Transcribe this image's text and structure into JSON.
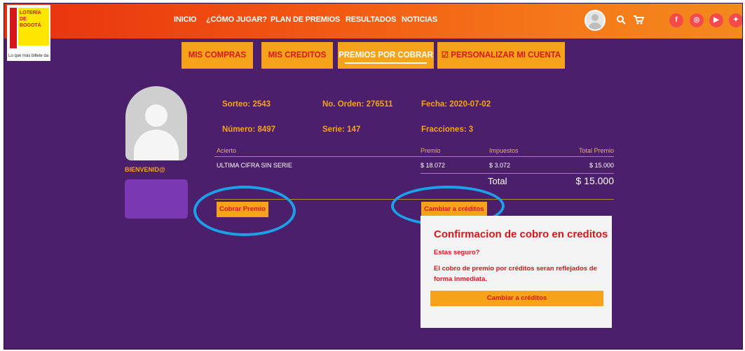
{
  "logo": {
    "line1": "LOTERÍA",
    "line2": "DE",
    "line3": "BOGOTÁ",
    "tagline": "Lo que más billete da"
  },
  "nav": [
    "INICIO",
    "¿CÓMO JUGAR?",
    "PLAN DE PREMIOS",
    "RESULTADOS",
    "NOTICIAS"
  ],
  "icons": {
    "search": "search-icon",
    "cart": "cart-icon",
    "social": [
      "facebook-icon",
      "instagram-icon",
      "youtube-icon",
      "twitter-icon"
    ]
  },
  "social_glyphs": [
    "f",
    "◎",
    "▶",
    "✦"
  ],
  "tabs": [
    "MIS COMPRAS",
    "MIS CREDITOS",
    "PREMIOS POR COBRAR",
    "☑ PERSONALIZAR MI CUENTA"
  ],
  "profile": {
    "welcome": "BIENVENID@"
  },
  "purchase": {
    "sorteo": "Sorteo: 2543",
    "orden": "No. Orden: 276511",
    "fecha": "Fecha: 2020-07-02",
    "numero": "Número: 8497",
    "serie": "Serie: 147",
    "fracciones": "Fracciones: 3"
  },
  "table": {
    "headers": [
      "Acierto",
      "Premio",
      "Impuestos",
      "Total Premio"
    ],
    "rows": [
      [
        "ULTIMA CIFRA SIN SERIE",
        "$ 18.072",
        "$ 3.072",
        "$ 15.000"
      ]
    ],
    "total_label": "Total",
    "total_value": "$ 15.000"
  },
  "buttons": {
    "cobrar": "Cobrar Premio",
    "cambiar": "Cambiar a créditos"
  },
  "confirm": {
    "title": "Confirmacion de cobro en creditos",
    "question": "Estas seguro?",
    "message": "El cobro de premio por créditos seran reflejados de forma inmediata.",
    "button": "Cambiar a créditos"
  },
  "colors": {
    "bar": "#f25a12",
    "bg": "#4b1f6b",
    "accent": "#f5a31a",
    "red": "#d7161b",
    "highlight": "#1ea0e8"
  }
}
